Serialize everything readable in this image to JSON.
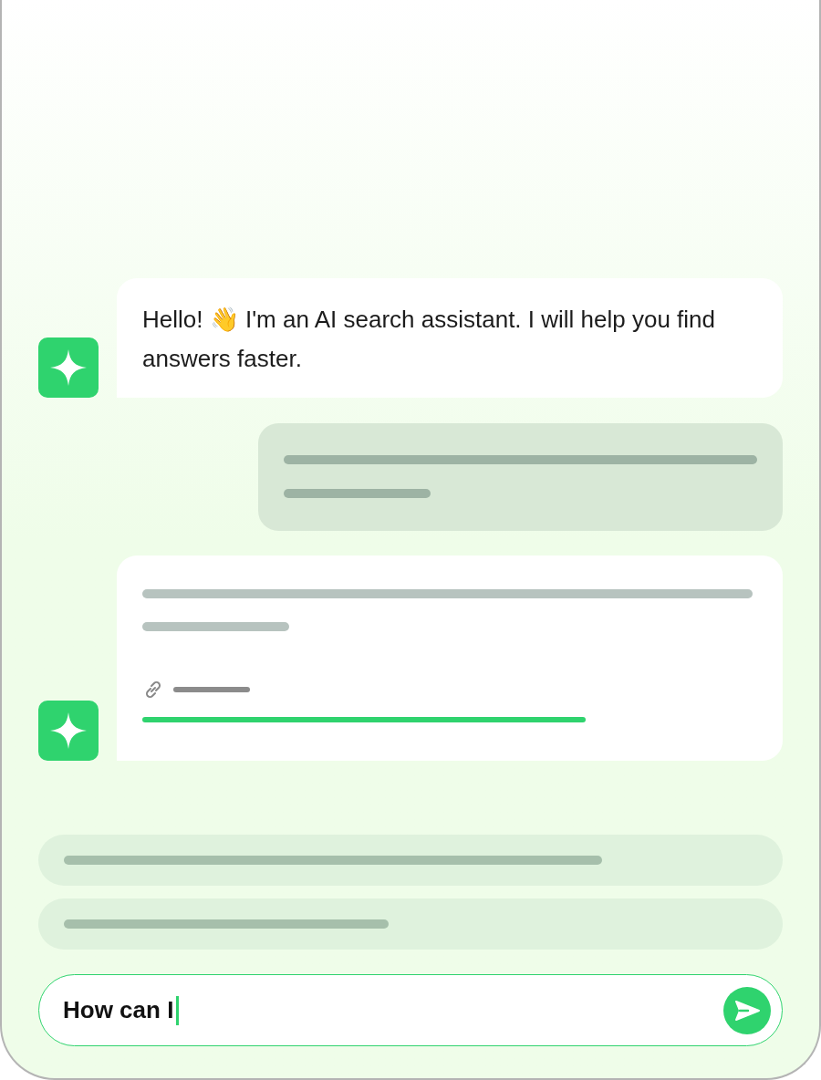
{
  "messages": [
    {
      "kind": "bot_text",
      "text": "Hello! 👋 I'm an AI search assistant. I will help you find answers faster."
    },
    {
      "kind": "user_skeleton"
    },
    {
      "kind": "bot_skeleton_link"
    }
  ],
  "suggestions": [
    {
      "kind": "skeleton"
    },
    {
      "kind": "skeleton"
    }
  ],
  "input": {
    "value": "How can I"
  }
}
